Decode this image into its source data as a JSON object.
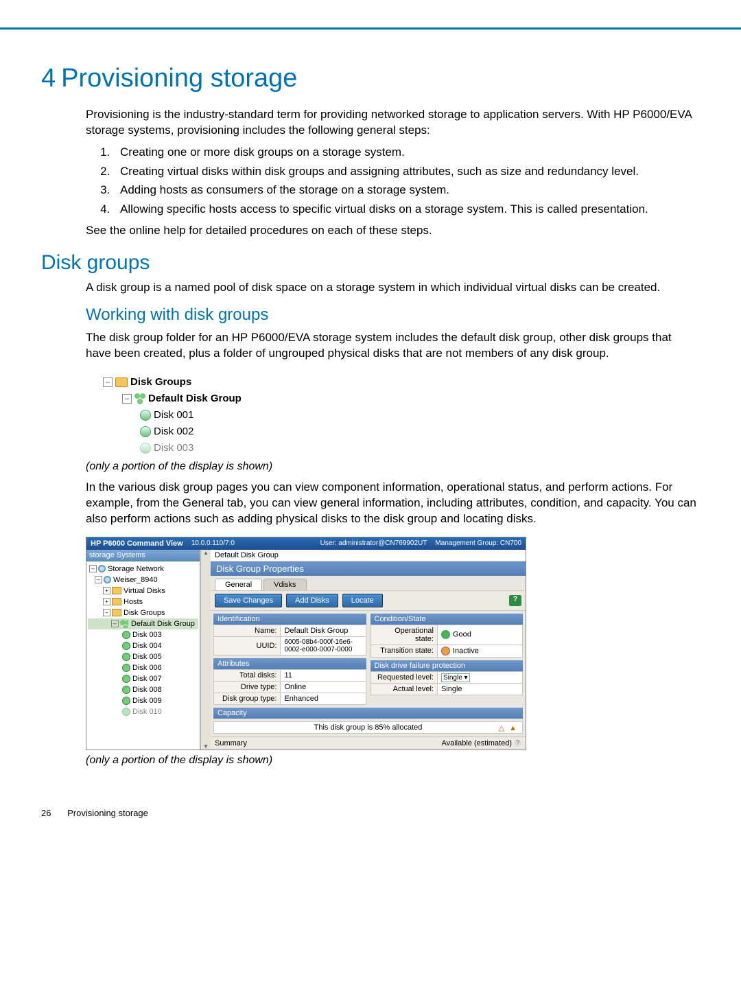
{
  "chapter": {
    "num": "4",
    "title": "Provisioning storage"
  },
  "intro": "Provisioning is the industry-standard term for providing networked storage to application servers. With HP P6000/EVA storage systems, provisioning includes the following general steps:",
  "steps": [
    "Creating one or more disk groups on a storage system.",
    "Creating virtual disks within disk groups and assigning attributes, such as size and redundancy level.",
    "Adding hosts as consumers of the storage on a storage system.",
    "Allowing specific hosts access to specific virtual disks on a storage system. This is called presentation."
  ],
  "see_help": "See the online help for detailed procedures on each of these steps.",
  "section_diskgroups": {
    "title": "Disk groups",
    "para": "A disk group is a named pool of disk space on a storage system in which individual virtual disks can be created."
  },
  "subsection_working": {
    "title": "Working with disk groups",
    "para": "The disk group folder for an HP P6000/EVA storage system includes the default disk group, other disk groups that have been created, plus a folder of ungrouped physical disks that are not members of any disk group."
  },
  "tree1": {
    "root": "Disk Groups",
    "group": "Default Disk Group",
    "disks": [
      "Disk 001",
      "Disk 002",
      "Disk 003"
    ]
  },
  "caption": "(only a portion of the display is shown)",
  "para_after_tree": "In the various disk group pages you can view component information, operational status, and perform actions. For example, from the General tab, you can view general information, including attributes, condition, and capacity. You can also perform actions such as adding physical disks to the disk group and locating disks.",
  "shot": {
    "titlebar": {
      "app": "HP P6000 Command View",
      "ip": "10.0.0.110/7:0",
      "user": "User: administrator@CN769902UT",
      "mg": "Management Group: CN700"
    },
    "left_header": "storage Systems",
    "left_tree": {
      "root": "Storage Network",
      "sys": "Weiser_8940",
      "virtual_disks": "Virtual Disks",
      "hosts": "Hosts",
      "disk_groups": "Disk Groups",
      "default_group": "Default Disk Group",
      "disks": [
        "Disk 003",
        "Disk 004",
        "Disk 005",
        "Disk 006",
        "Disk 007",
        "Disk 008",
        "Disk 009",
        "Disk 010"
      ]
    },
    "breadcrumb": "Default Disk Group",
    "panel_title": "Disk Group Properties",
    "tabs": {
      "general": "General",
      "vdisks": "Vdisks"
    },
    "buttons": {
      "save": "Save Changes",
      "add": "Add Disks",
      "locate": "Locate",
      "help": "?"
    },
    "identification": {
      "hdr": "Identification",
      "name_k": "Name:",
      "name_v": "Default Disk Group",
      "uuid_k": "UUID:",
      "uuid_v": "6005-08b4-000f-16e6-0002-e000-0007-0000"
    },
    "condition": {
      "hdr": "Condition/State",
      "op_k": "Operational state:",
      "op_v": "Good",
      "tr_k": "Transition state:",
      "tr_v": "Inactive"
    },
    "protection": {
      "hdr": "Disk drive failure protection",
      "req_k": "Requested level:",
      "req_v": "Single",
      "act_k": "Actual level:",
      "act_v": "Single"
    },
    "attributes": {
      "hdr": "Attributes",
      "total_k": "Total disks:",
      "total_v": "11",
      "drive_k": "Drive type:",
      "drive_v": "Online",
      "dgt_k": "Disk group type:",
      "dgt_v": "Enhanced"
    },
    "capacity": {
      "hdr": "Capacity",
      "msg": "This disk group is 85% allocated"
    },
    "summary": {
      "label": "Summary",
      "avail": "Available (estimated)"
    }
  },
  "footer": {
    "page": "26",
    "title": "Provisioning storage"
  }
}
